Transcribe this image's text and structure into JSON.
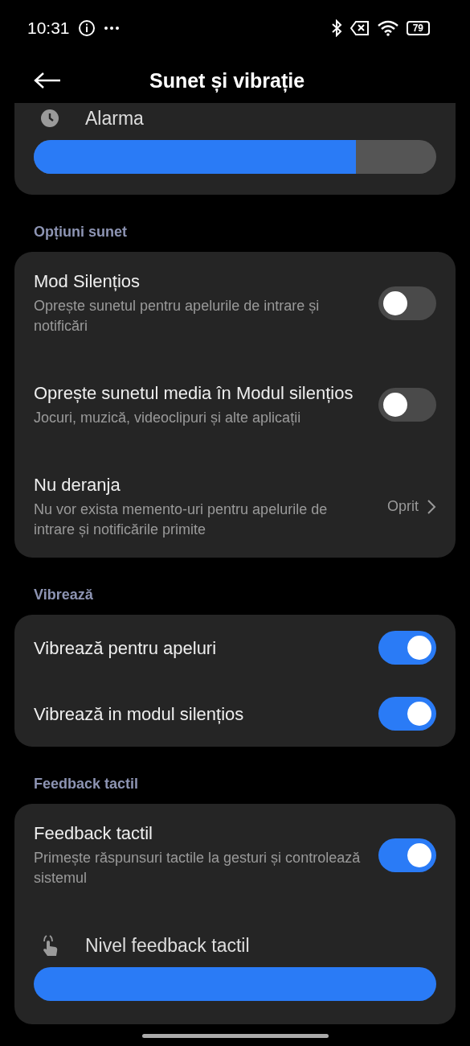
{
  "status_bar": {
    "time": "10:31",
    "battery": "79"
  },
  "header": {
    "title": "Sunet și vibrație"
  },
  "top_card": {
    "rows": [
      {
        "kind": "slider",
        "title": "Alarma",
        "level": 0.8
      }
    ]
  },
  "sections": [
    {
      "title": "Opțiuni sunet",
      "rows": [
        {
          "kind": "toggle",
          "title": "Mod Silențios",
          "subtitle": "Oprește sunetul pentru apelurile de intrare și notificări",
          "on": false
        },
        {
          "kind": "toggle",
          "title": "Oprește sunetul media în Modul silențios",
          "subtitle": "Jocuri, muzică, videoclipuri și alte aplicații",
          "on": false
        },
        {
          "kind": "link",
          "title": "Nu deranja",
          "subtitle": "Nu vor exista memento-uri pentru apelurile de intrare și notificările primite",
          "value": "Oprit"
        }
      ]
    },
    {
      "title": "Vibrează",
      "rows": [
        {
          "kind": "toggle",
          "title": "Vibrează pentru apeluri",
          "on": true
        },
        {
          "kind": "toggle",
          "title": "Vibrează in modul silențios",
          "on": true
        }
      ]
    },
    {
      "title": "Feedback tactil",
      "rows": [
        {
          "kind": "toggle",
          "title": "Feedback tactil",
          "subtitle": "Primește răspunsuri tactile la gesturi și controlează sistemul",
          "on": true
        },
        {
          "kind": "slider",
          "title": "Nivel feedback tactil",
          "level": 1.0
        }
      ]
    }
  ]
}
